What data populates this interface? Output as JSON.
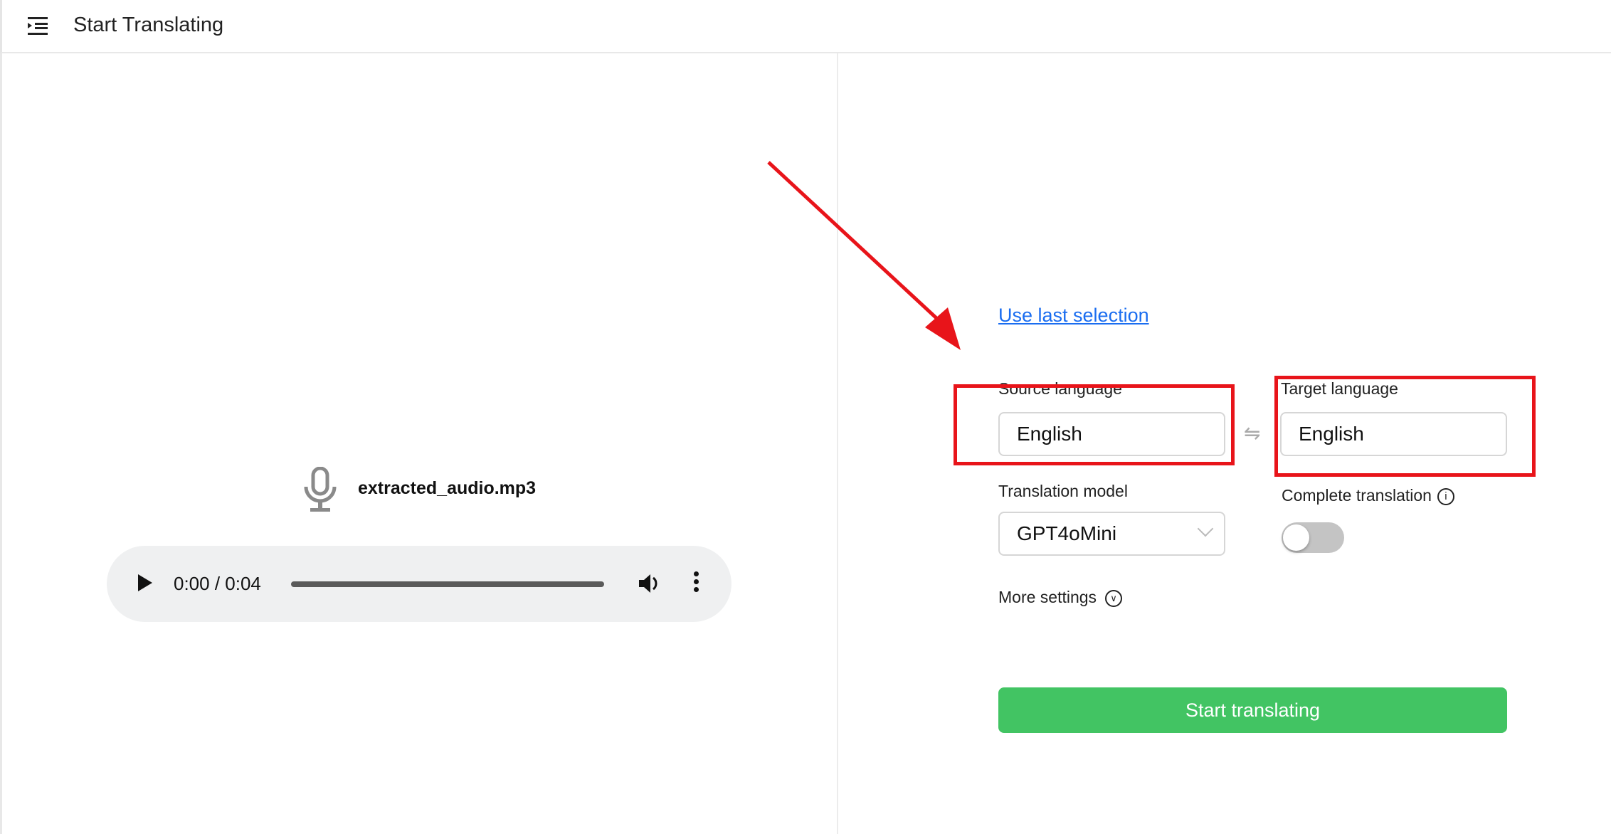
{
  "header": {
    "title": "Start Translating"
  },
  "file": {
    "name": "extracted_audio.mp3",
    "time": "0:00 / 0:04",
    "progress_percent": 0
  },
  "form": {
    "use_last_selection": "Use last selection",
    "source_label": "Source language",
    "source_value": "English",
    "target_label": "Target language",
    "target_value": "English",
    "model_label": "Translation model",
    "model_value": "GPT4oMini",
    "complete_label": "Complete translation",
    "complete_enabled": false,
    "more_settings": "More settings",
    "start_button": "Start translating"
  },
  "colors": {
    "accent_green": "#42c463",
    "link_blue": "#1a6df0",
    "annotation_red": "#e8141a"
  }
}
